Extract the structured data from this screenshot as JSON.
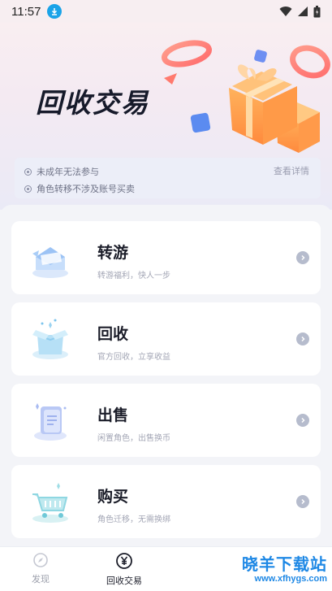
{
  "status_bar": {
    "time": "11:57"
  },
  "hero": {
    "title": "回收交易"
  },
  "notice": {
    "lines": [
      "未成年无法参与",
      "角色转移不涉及账号买卖"
    ],
    "detail_link": "查看详情"
  },
  "cards": [
    {
      "title": "转游",
      "subtitle": "转游福利，快人一步",
      "icon": "envelope-icon"
    },
    {
      "title": "回收",
      "subtitle": "官方回收，立享收益",
      "icon": "open-box-icon"
    },
    {
      "title": "出售",
      "subtitle": "闲置角色，出售换币",
      "icon": "document-icon"
    },
    {
      "title": "购买",
      "subtitle": "角色迁移，无需换绑",
      "icon": "cart-icon"
    }
  ],
  "tabbar": {
    "tabs": [
      {
        "label": "发现",
        "icon": "discover-icon",
        "active": false
      },
      {
        "label": "回收交易",
        "icon": "yen-icon",
        "active": true
      }
    ]
  },
  "watermark": {
    "main": "晓羊下载站",
    "url": "www.xfhygs.com"
  },
  "colors": {
    "accent": "#1e88e5",
    "card_bg": "#ffffff",
    "page_bg": "#f3f4f8",
    "title": "#1b1d29"
  }
}
